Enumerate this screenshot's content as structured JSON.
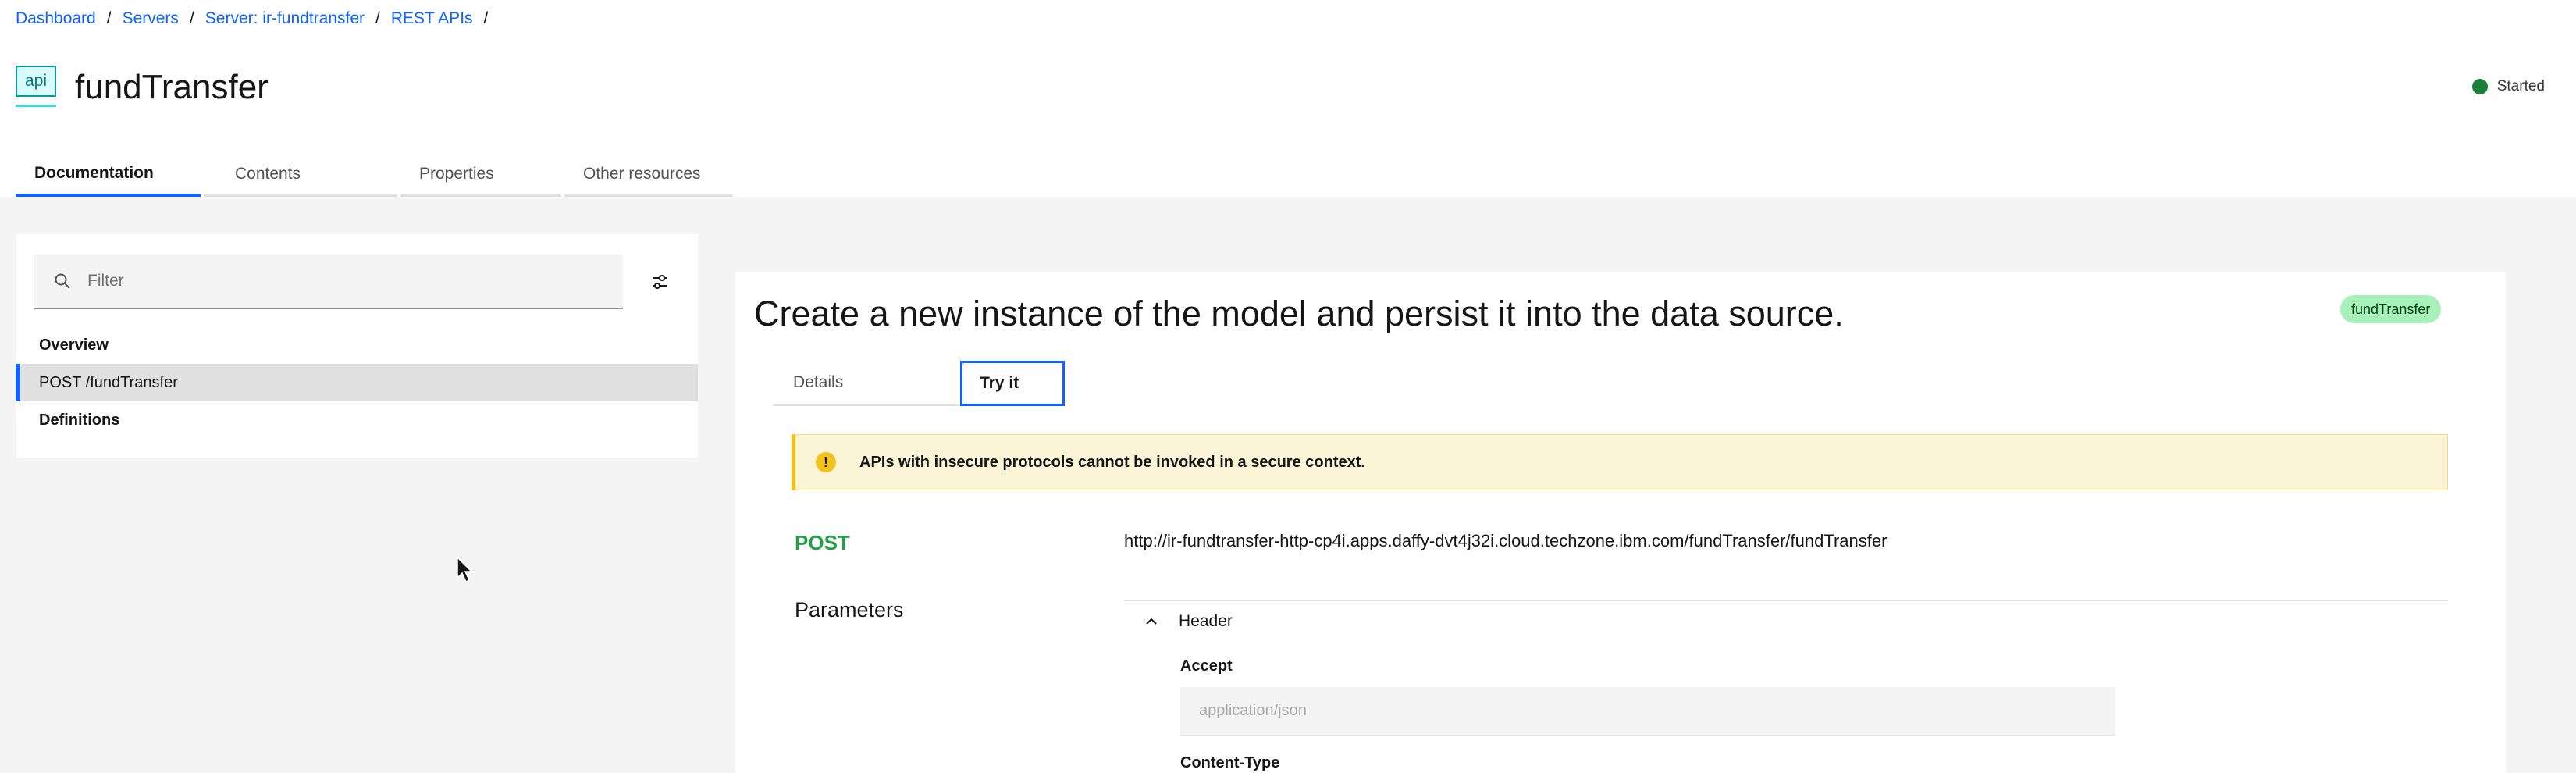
{
  "breadcrumb": {
    "items": [
      "Dashboard",
      "Servers",
      "Server: ir-fundtransfer",
      "REST APIs"
    ],
    "separator": "/"
  },
  "header": {
    "icon_label": "api",
    "title": "fundTransfer",
    "status": "Started",
    "status_color": "#198038"
  },
  "tabs": [
    "Documentation",
    "Contents",
    "Properties",
    "Other resources"
  ],
  "sidebar": {
    "filter_placeholder": "Filter",
    "items": [
      "Overview",
      "POST /fundTransfer",
      "Definitions"
    ]
  },
  "operation": {
    "title": "Create a new instance of the model and persist it into the data source.",
    "tag": "fundTransfer",
    "subtabs": [
      "Details",
      "Try it"
    ],
    "warning": "APIs with insecure protocols cannot be invoked in a secure context.",
    "method": "POST",
    "url": "http://ir-fundtransfer-http-cp4i.apps.daffy-dvt4j32i.cloud.techzone.ibm.com/fundTransfer/fundTransfer",
    "parameters_label": "Parameters",
    "header_section": "Header",
    "accept_label": "Accept",
    "accept_placeholder": "application/json",
    "content_type_label": "Content-Type"
  },
  "colors": {
    "accent": "#0f62fe",
    "method_post": "#24a148",
    "warning_bg": "#fcf4d6",
    "tag_bg": "#a7f0ba"
  }
}
